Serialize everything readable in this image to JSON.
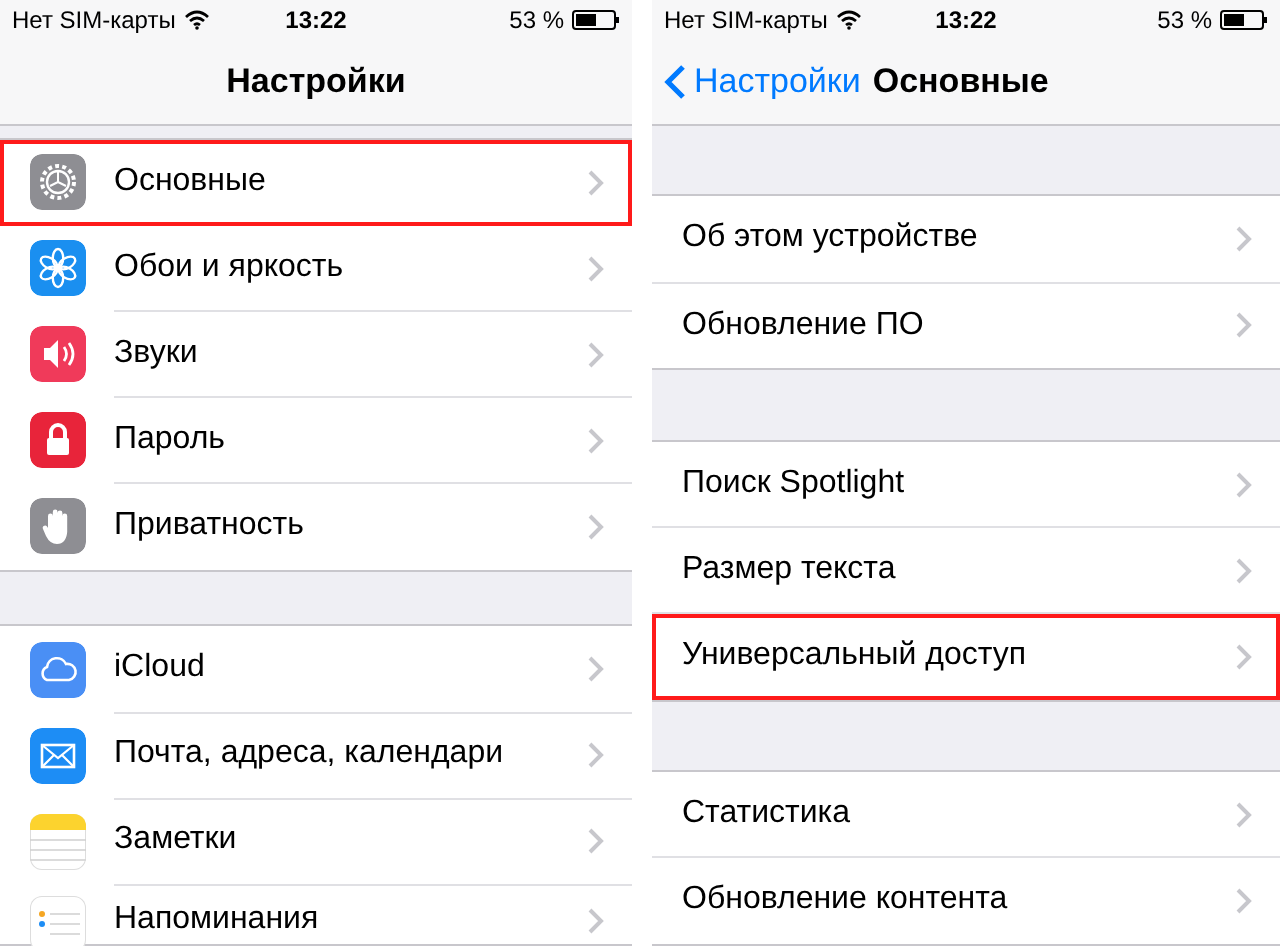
{
  "screens": [
    {
      "status_bar": {
        "carrier": "Нет SIM-карты",
        "time": "13:22",
        "battery": "53 %"
      },
      "nav": {
        "title": "Настройки"
      },
      "groups": [
        {
          "rows": [
            {
              "label": "Основные",
              "highlighted": true
            },
            {
              "label": "Обои и яркость",
              "highlighted": false
            },
            {
              "label": "Звуки",
              "highlighted": false
            },
            {
              "label": "Пароль",
              "highlighted": false
            },
            {
              "label": "Приватность",
              "highlighted": false
            }
          ]
        },
        {
          "rows": [
            {
              "label": "iCloud",
              "highlighted": false
            },
            {
              "label": "Почта, адреса, календари",
              "highlighted": false
            },
            {
              "label": "Заметки",
              "highlighted": false
            },
            {
              "label": "Напоминания",
              "highlighted": false
            }
          ]
        }
      ]
    },
    {
      "status_bar": {
        "carrier": "Нет SIM-карты",
        "time": "13:22",
        "battery": "53 %"
      },
      "nav": {
        "back": "Настройки",
        "title": "Основные"
      },
      "groups": [
        {
          "rows": [
            {
              "label": "Об этом устройстве",
              "highlighted": false
            },
            {
              "label": "Обновление ПО",
              "highlighted": false
            }
          ]
        },
        {
          "rows": [
            {
              "label": "Поиск Spotlight",
              "highlighted": false
            },
            {
              "label": "Размер текста",
              "highlighted": false
            },
            {
              "label": "Универсальный доступ",
              "highlighted": true
            }
          ]
        },
        {
          "rows": [
            {
              "label": "Статистика",
              "highlighted": false
            },
            {
              "label": "Обновление контента",
              "highlighted": false
            }
          ]
        }
      ]
    }
  ]
}
